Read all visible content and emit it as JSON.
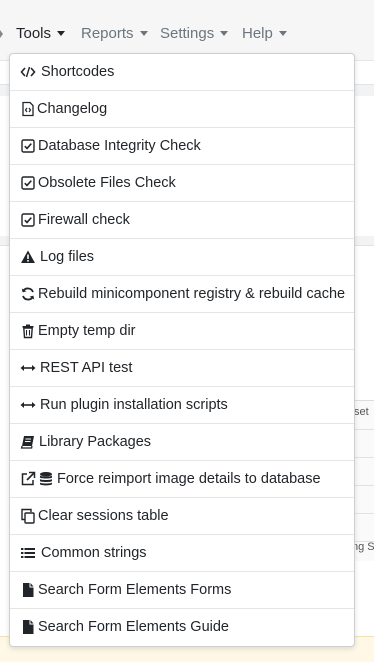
{
  "nav": {
    "items": [
      {
        "label": "Tools"
      },
      {
        "label": "Reports"
      },
      {
        "label": "Settings"
      },
      {
        "label": "Help"
      }
    ]
  },
  "tools_menu": {
    "items": [
      {
        "label": "Shortcodes",
        "icon": "code-icon"
      },
      {
        "label": "Changelog",
        "icon": "code-file-icon"
      },
      {
        "label": "Database Integrity Check",
        "icon": "check-square-icon"
      },
      {
        "label": "Obsolete Files Check",
        "icon": "check-square-icon"
      },
      {
        "label": "Firewall check",
        "icon": "check-square-icon"
      },
      {
        "label": "Log files",
        "icon": "warning-icon"
      },
      {
        "label": "Rebuild minicomponent registry & rebuild cache",
        "icon": "sync-icon"
      },
      {
        "label": "Empty temp dir",
        "icon": "trash-icon"
      },
      {
        "label": "REST API test",
        "icon": "arrows-h-icon"
      },
      {
        "label": "Run plugin installation scripts",
        "icon": "arrows-h-icon"
      },
      {
        "label": "Library Packages",
        "icon": "book-icon"
      },
      {
        "label": "Force reimport image details to database",
        "icon": "external-link-icon",
        "icon2": "database-icon"
      },
      {
        "label": "Clear sessions table",
        "icon": "copy-icon"
      },
      {
        "label": "Common strings",
        "icon": "list-icon"
      },
      {
        "label": "Search Form Elements Forms",
        "icon": "file-icon"
      },
      {
        "label": "Search Form Elements Guide",
        "icon": "file-icon"
      }
    ]
  },
  "background": {
    "table_header": "set",
    "table_footer": "ng  S"
  }
}
